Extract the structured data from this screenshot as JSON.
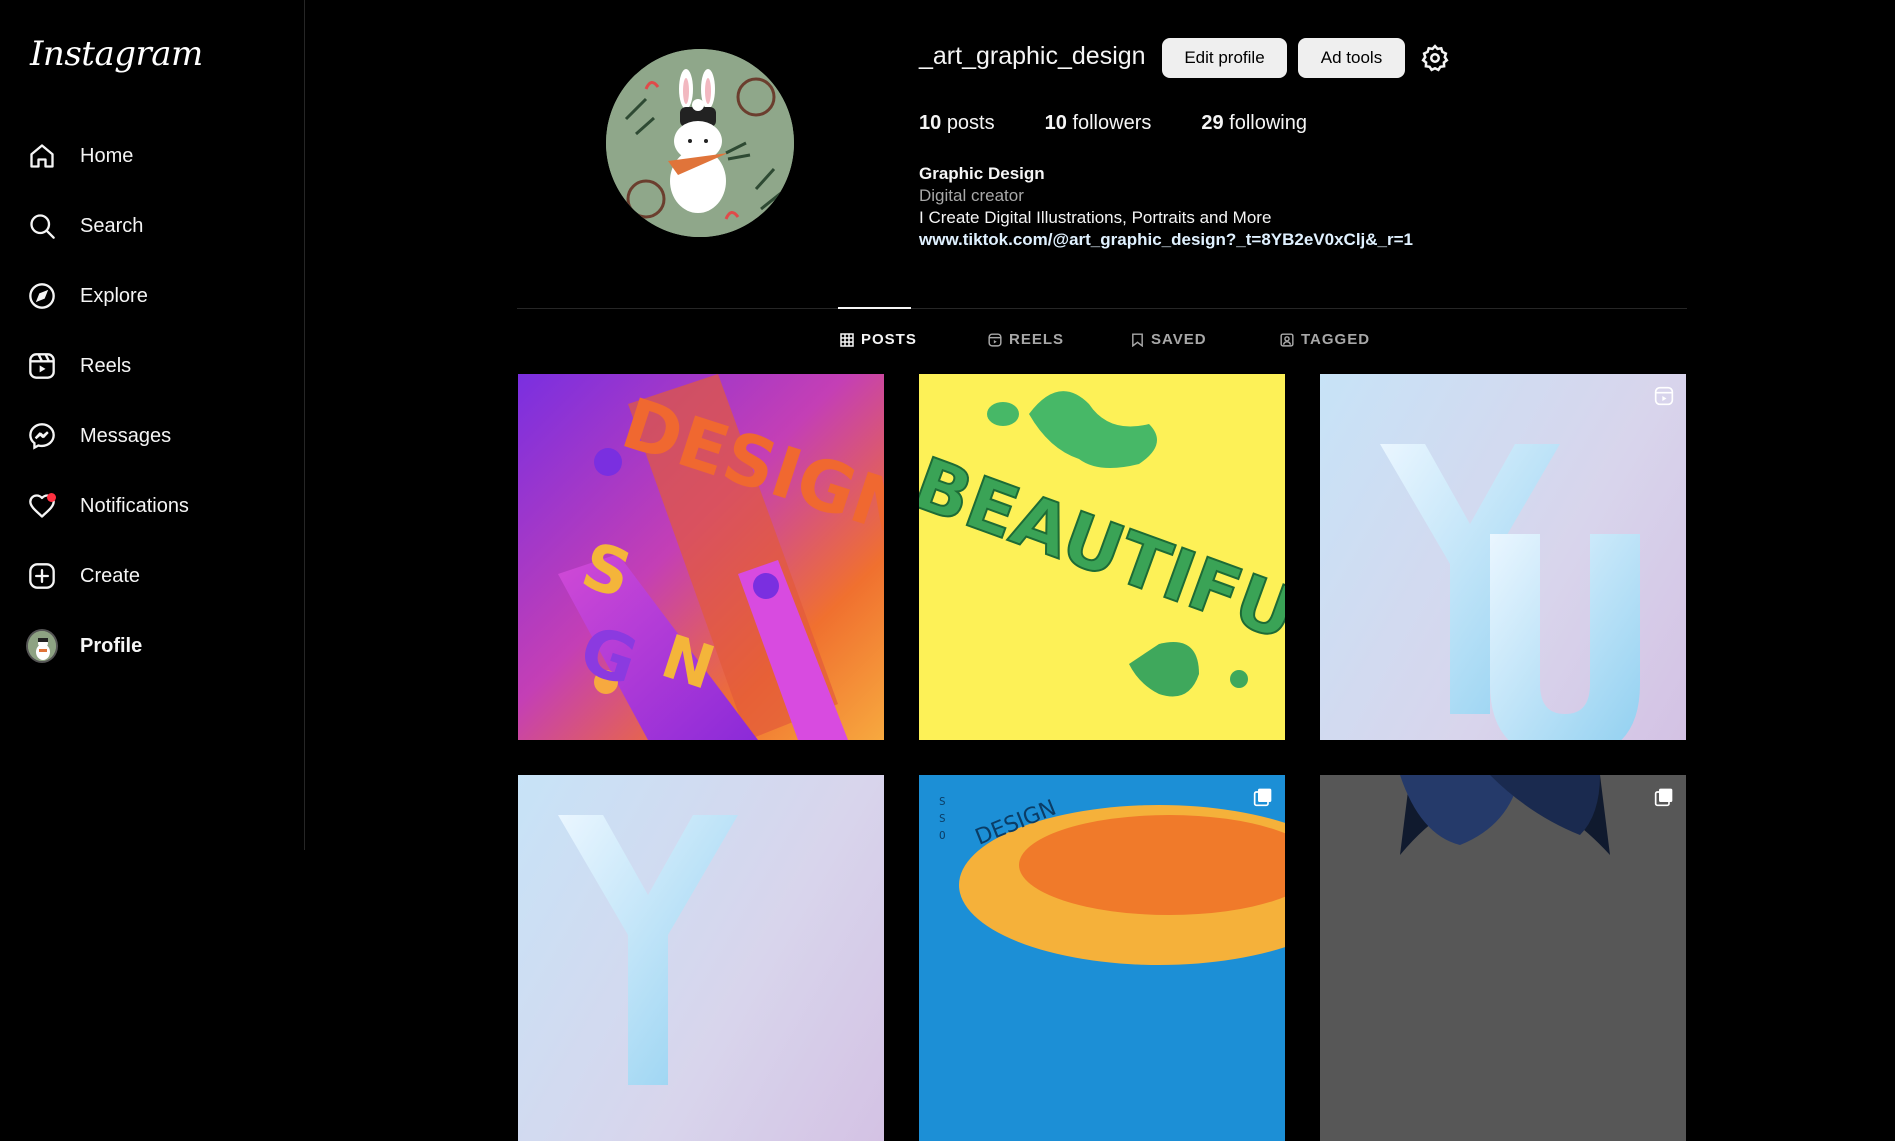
{
  "logo": "Instagram",
  "nav": [
    {
      "label": "Home",
      "icon": "home-icon"
    },
    {
      "label": "Search",
      "icon": "search-icon"
    },
    {
      "label": "Explore",
      "icon": "explore-icon"
    },
    {
      "label": "Reels",
      "icon": "reels-icon"
    },
    {
      "label": "Messages",
      "icon": "messages-icon"
    },
    {
      "label": "Notifications",
      "icon": "heart-icon"
    },
    {
      "label": "Create",
      "icon": "plus-square-icon"
    },
    {
      "label": "Profile",
      "icon": "avatar"
    }
  ],
  "profile": {
    "username": "_art_graphic_design",
    "edit_button": "Edit profile",
    "ad_button": "Ad tools",
    "stats": {
      "posts_count": "10",
      "posts_label": "posts",
      "followers_count": "10",
      "followers_label": "followers",
      "following_count": "29",
      "following_label": "following"
    },
    "bio": {
      "name": "Graphic Design",
      "category": "Digital creator",
      "description": "I Create Digital Illustrations, Portraits and More",
      "link": "www.tiktok.com/@art_graphic_design?_t=8YB2eV0xClj&_r=1"
    }
  },
  "tabs": [
    {
      "label": "POSTS",
      "icon": "grid-icon",
      "active": true
    },
    {
      "label": "REELS",
      "icon": "reels-icon",
      "active": false
    },
    {
      "label": "SAVED",
      "icon": "bookmark-icon",
      "active": false
    },
    {
      "label": "TAGGED",
      "icon": "tagged-icon",
      "active": false
    }
  ],
  "posts": {
    "p1_text": "DESIGN",
    "p2_text": "BEAUTIFU",
    "p3_text": "YU",
    "p4_text": "Y",
    "p5_text": "DESIGN",
    "p5_side": [
      "S",
      "S",
      "O"
    ]
  },
  "colors": {
    "background": "#000000",
    "notification_dot": "#ff3040",
    "button_bg": "#efefef",
    "link": "#e0f1ff"
  }
}
